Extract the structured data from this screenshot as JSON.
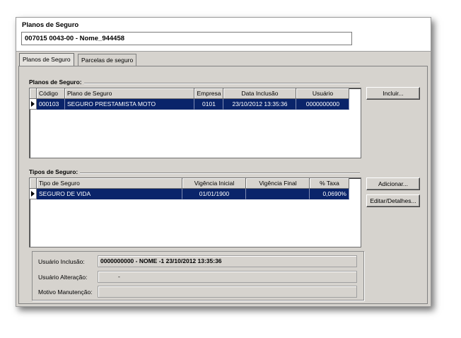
{
  "header": {
    "title": "Planos de Seguro",
    "record": "007015 0043-00 - Nome_944458"
  },
  "tabs": [
    {
      "label": "Planos de Seguro",
      "active": true
    },
    {
      "label": "Parcelas de seguro",
      "active": false
    }
  ],
  "planos": {
    "group_label": "Planos de Seguro:",
    "columns": [
      "Código",
      "Plano de Seguro",
      "Empresa",
      "Data Inclusão",
      "Usuário"
    ],
    "rows": [
      [
        "000103",
        "SEGURO PRESTAMISTA MOTO",
        "0101",
        "23/10/2012 13:35:36",
        "0000000000"
      ]
    ],
    "button_incluir": "Incluir..."
  },
  "tipos": {
    "group_label": "Tipos de Seguro:",
    "columns": [
      "Tipo de Seguro",
      "Vigência Inicial",
      "Vigência Final",
      "% Taxa"
    ],
    "rows": [
      [
        "SEGURO DE VIDA",
        "01/01/1900",
        "",
        "0,0690%"
      ]
    ],
    "button_adicionar": "Adicionar...",
    "button_editar": "Editar/Detalhes..."
  },
  "info": {
    "usuario_inclusao_label": "Usuário Inclusão:",
    "usuario_inclusao_value": "0000000000 - NOME -1  23/10/2012 13:35:36",
    "usuario_alteracao_label": "Usuário Alteração:",
    "usuario_alteracao_value": "-",
    "motivo_label": "Motivo Manutenção:",
    "motivo_value": ""
  },
  "colors": {
    "window_bg": "#d6d3ce",
    "selection": "#0a246a"
  }
}
